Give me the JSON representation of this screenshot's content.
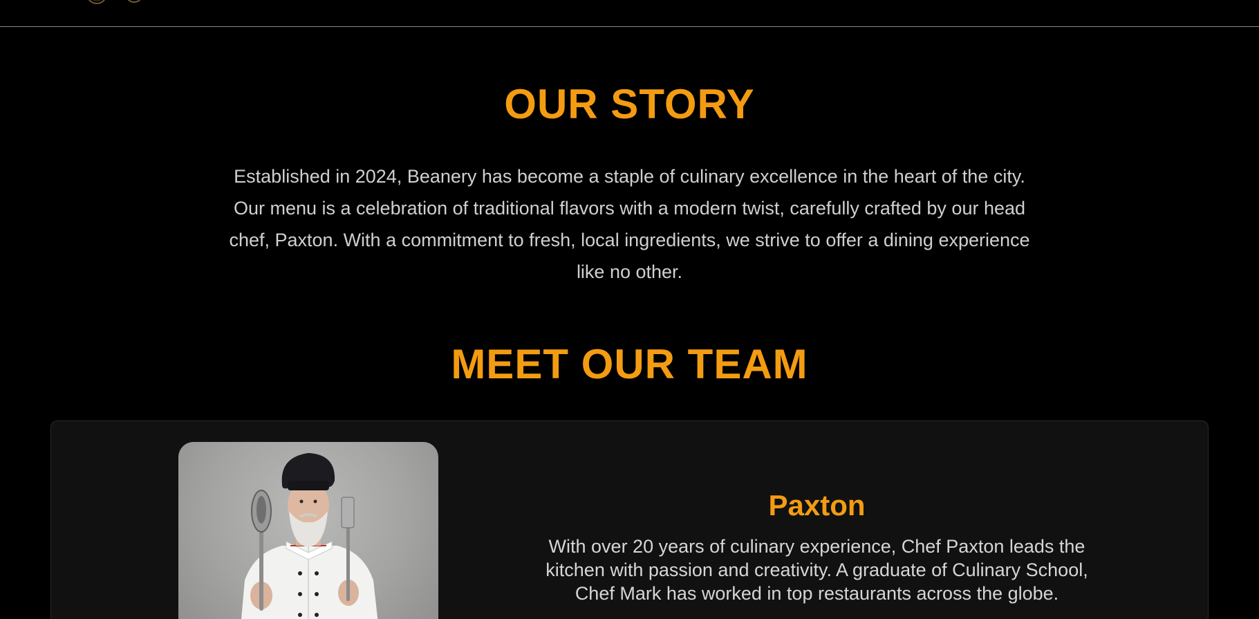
{
  "story": {
    "title": "OUR STORY",
    "paragraph": "Established in 2024, Beanery has become a staple of culinary excellence in the heart of the city. Our menu is a celebration of traditional flavors with a modern twist, carefully crafted by our head chef, Paxton. With a commitment to fresh, local ingredients, we strive to offer a dining experience like no other."
  },
  "team": {
    "title": "MEET OUR TEAM",
    "members": [
      {
        "name": "Paxton",
        "photo_icon": "chef-photo",
        "bio_lines": [
          "With over 20 years of culinary experience, Chef Paxton leads the",
          "kitchen with passion and creativity. A graduate of Culinary School,",
          "Chef Mark has worked in top restaurants across the globe."
        ]
      }
    ]
  },
  "colors": {
    "background": "#000000",
    "accent": "#f39c12",
    "text": "#d0d0d0",
    "card": "#111111"
  }
}
